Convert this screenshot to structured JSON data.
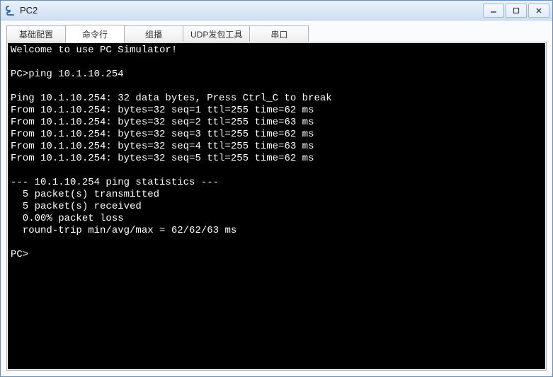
{
  "window": {
    "title": "PC2"
  },
  "tabs": [
    {
      "label": "基础配置",
      "active": false
    },
    {
      "label": "命令行",
      "active": true
    },
    {
      "label": "组播",
      "active": false
    },
    {
      "label": "UDP发包工具",
      "active": false
    },
    {
      "label": "串口",
      "active": false
    }
  ],
  "terminal": {
    "lines": [
      "Welcome to use PC Simulator!",
      "",
      "PC>ping 10.1.10.254",
      "",
      "Ping 10.1.10.254: 32 data bytes, Press Ctrl_C to break",
      "From 10.1.10.254: bytes=32 seq=1 ttl=255 time=62 ms",
      "From 10.1.10.254: bytes=32 seq=2 ttl=255 time=63 ms",
      "From 10.1.10.254: bytes=32 seq=3 ttl=255 time=62 ms",
      "From 10.1.10.254: bytes=32 seq=4 ttl=255 time=63 ms",
      "From 10.1.10.254: bytes=32 seq=5 ttl=255 time=62 ms",
      "",
      "--- 10.1.10.254 ping statistics ---",
      "  5 packet(s) transmitted",
      "  5 packet(s) received",
      "  0.00% packet loss",
      "  round-trip min/avg/max = 62/62/63 ms",
      "",
      "PC>"
    ]
  }
}
